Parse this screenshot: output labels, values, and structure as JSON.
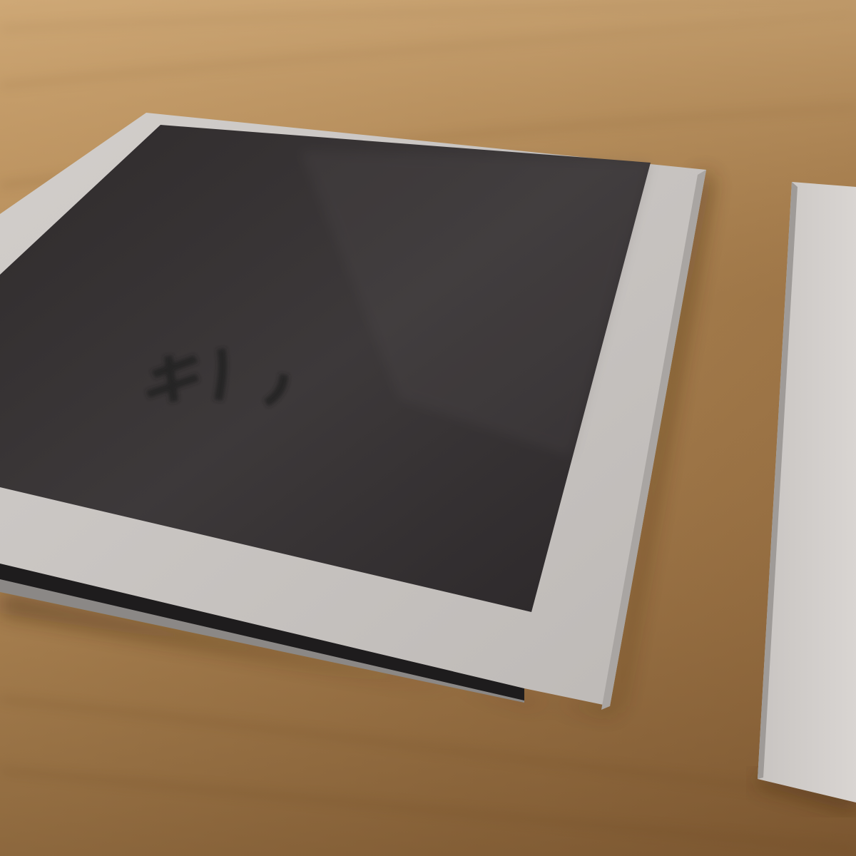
{
  "scene": {
    "cover_title": "",
    "colors": {
      "table_light": "#c79c64",
      "table_mid": "#a77a48",
      "table_dark": "#7d5833",
      "card_stock": "#cfcbc7",
      "card_stock_shadow": "#aaa6a2",
      "cover_print": "#3a3637",
      "cover_print_dark": "#2a2628",
      "back_cover": "#1e1c1d"
    },
    "objects": [
      "booklet-sleeve",
      "printed-cover",
      "embossed-title",
      "second-card"
    ]
  }
}
